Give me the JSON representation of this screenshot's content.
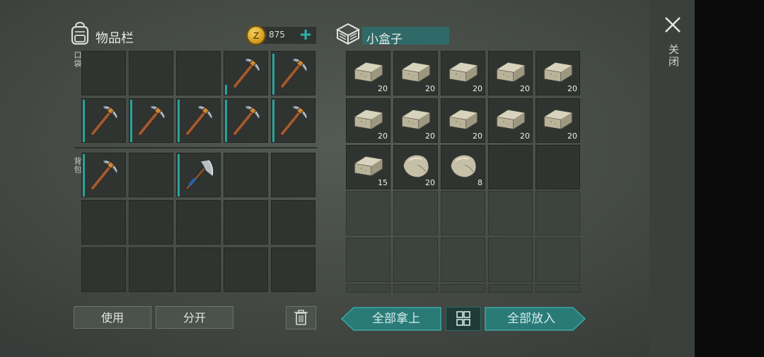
{
  "inventory": {
    "title": "物品栏",
    "coins": "875",
    "pocket_label": "口袋",
    "backpack_label": "背包"
  },
  "container": {
    "title": "小盒子",
    "slots": [
      {
        "item": "stone-brick",
        "qty": "20"
      },
      {
        "item": "stone-brick",
        "qty": "20"
      },
      {
        "item": "stone-brick",
        "qty": "20"
      },
      {
        "item": "stone-brick",
        "qty": "20"
      },
      {
        "item": "stone-brick",
        "qty": "20"
      },
      {
        "item": "stone-brick",
        "qty": "20"
      },
      {
        "item": "stone-brick",
        "qty": "20"
      },
      {
        "item": "stone-brick",
        "qty": "20"
      },
      {
        "item": "stone-brick",
        "qty": "20"
      },
      {
        "item": "stone-brick",
        "qty": "20"
      },
      {
        "item": "stone-brick",
        "qty": "15"
      },
      {
        "item": "stone",
        "qty": "20"
      },
      {
        "item": "stone",
        "qty": "8"
      }
    ]
  },
  "actions": {
    "use": "使用",
    "split": "分开",
    "take_all": "全部拿上",
    "put_all": "全部放入",
    "close": "关闭"
  },
  "colors": {
    "accent": "#2fb0a6",
    "teal_button": "#2a7a78",
    "durability": "#2aa199"
  },
  "icons": {
    "pickaxe": "pickaxe-icon",
    "axe": "axe-icon",
    "brick": "stone-brick-icon",
    "stone": "stone-icon"
  }
}
